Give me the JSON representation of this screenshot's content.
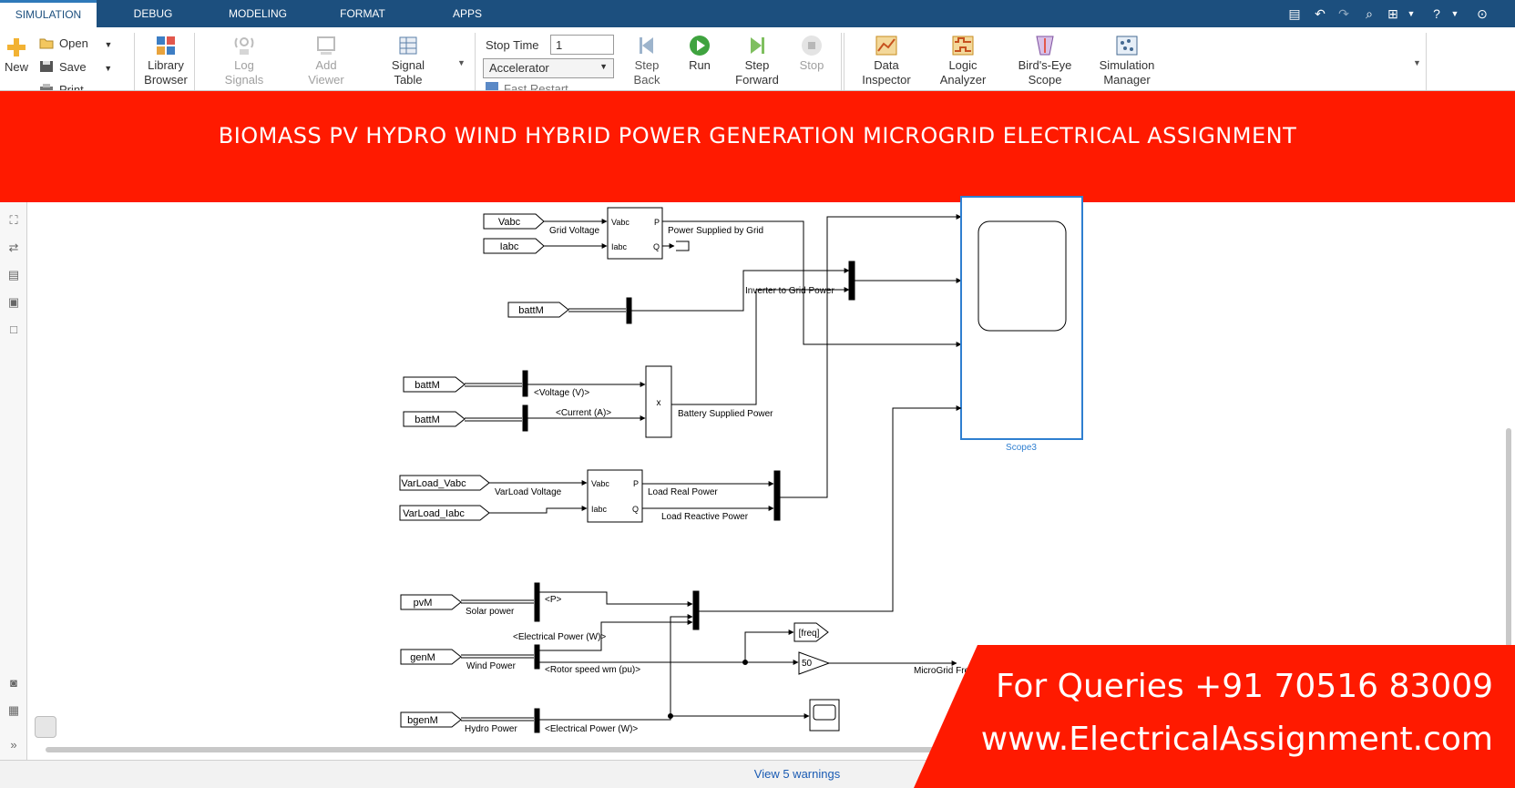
{
  "tabs": [
    {
      "label": "SIMULATION",
      "active": true
    },
    {
      "label": "DEBUG",
      "active": false
    },
    {
      "label": "MODELING",
      "active": false
    },
    {
      "label": "FORMAT",
      "active": false
    },
    {
      "label": "APPS",
      "active": false
    }
  ],
  "ribbon": {
    "file": {
      "new": "New",
      "open": "Open",
      "save": "Save",
      "print": "Print"
    },
    "library": {
      "label_1": "Library",
      "label_2": "Browser"
    },
    "prepare": {
      "log_1": "Log",
      "log_2": "Signals",
      "add_1": "Add",
      "add_2": "Viewer",
      "signal_1": "Signal",
      "signal_2": "Table"
    },
    "simulate": {
      "stop_time_label": "Stop Time",
      "stop_time_value": "1",
      "mode": "Accelerator",
      "fast_restart": "Fast Restart",
      "step_back_1": "Step",
      "step_back_2": "Back",
      "run": "Run",
      "step_forward_1": "Step",
      "step_forward_2": "Forward",
      "stop": "Stop"
    },
    "review": {
      "data_1": "Data",
      "data_2": "Inspector",
      "logic_1": "Logic",
      "logic_2": "Analyzer",
      "bird_1": "Bird's-Eye",
      "bird_2": "Scope",
      "sim_1": "Simulation",
      "sim_2": "Manager"
    }
  },
  "banner": "BIOMASS PV HYDRO WIND HYBRID POWER GENERATION MICROGRID ELECTRICAL ASSIGNMENT",
  "diagram": {
    "from_vabc": "Vabc",
    "from_iabc": "Iabc",
    "grid_voltage": "Grid Voltage",
    "pq_vabc": "Vabc",
    "pq_iabc": "Iabc",
    "pq_p": "P",
    "pq_q": "Q",
    "power_supplied_by_grid": "Power Supplied by Grid",
    "inverter_to_grid": "Inverter to Grid Power",
    "battM_1": "battM",
    "battM_2": "battM",
    "battM_3": "battM",
    "voltage_v": "<Voltage (V)>",
    "current_a": "<Current (A)>",
    "product_x": "x",
    "battery_supplied_power": "Battery Supplied Power",
    "varload_vabc": "VarLoad_Vabc",
    "varload_iabc": "VarLoad_Iabc",
    "varload_voltage": "VarLoad Voltage",
    "pq2_vabc": "Vabc",
    "pq2_iabc": "Iabc",
    "pq2_p": "P",
    "pq2_q": "Q",
    "load_real_power": "Load Real Power",
    "load_reactive_power": "Load Reactive Power",
    "scope3": "Scope3",
    "pvM": "pvM",
    "solar_power": "Solar power",
    "sel_p": "<P>",
    "genM": "genM",
    "wind_power": "Wind  Power",
    "electrical_power_w_1": "<Electrical Power (W)>",
    "rotor_speed": "<Rotor speed  wm  (pu)>",
    "bgenM": "bgenM",
    "hydro_power": "Hydro  Power",
    "electrical_power_w_2": "<Electrical Power (W)>",
    "goto_freq": "[freq]",
    "gain_50": "50",
    "microgrid_freq": "MicroGrid Fre"
  },
  "status": {
    "warnings": "View 5 warnings"
  },
  "promo": {
    "line1": "For Queries +91 70516 83009",
    "line2": "www.ElectricalAssignment.com"
  },
  "colors": {
    "tabbar": "#1c4f7e",
    "banner": "#ff1a00",
    "scope_blue": "#2f7fd0",
    "link_blue": "#1a5bb3"
  }
}
